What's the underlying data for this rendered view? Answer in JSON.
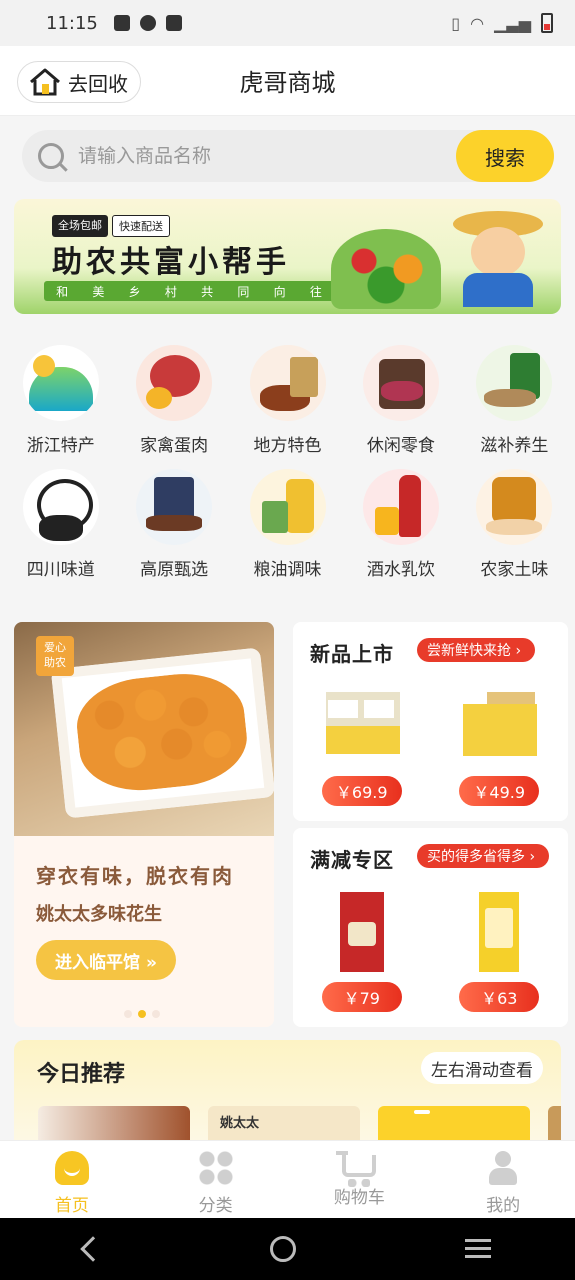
{
  "status_bar": {
    "time": "11:15"
  },
  "header": {
    "title": "虎哥商城",
    "recycle_label": "去回收"
  },
  "search": {
    "placeholder": "请输入商品名称",
    "button_label": "搜索"
  },
  "banner": {
    "tags": [
      "全场包邮",
      "快速配送"
    ],
    "title": "助农共富小帮手",
    "subtitle_chars": [
      "和",
      "美",
      "乡",
      "村",
      "共",
      "同",
      "向",
      "往"
    ]
  },
  "categories": [
    {
      "label": "浙江特产",
      "icon": "mountain-icon"
    },
    {
      "label": "家禽蛋肉",
      "icon": "meat-egg-icon"
    },
    {
      "label": "地方特色",
      "icon": "local-food-icon"
    },
    {
      "label": "休闲零食",
      "icon": "snack-icon"
    },
    {
      "label": "滋补养生",
      "icon": "health-icon"
    },
    {
      "label": "四川味道",
      "icon": "panda-icon"
    },
    {
      "label": "高原甄选",
      "icon": "plateau-icon"
    },
    {
      "label": "粮油调味",
      "icon": "oil-icon"
    },
    {
      "label": "酒水乳饮",
      "icon": "wine-icon"
    },
    {
      "label": "农家土味",
      "icon": "farm-icon"
    }
  ],
  "promo": {
    "badge": "爱心助农",
    "slogan": "穿衣有味，脱衣有肉",
    "product": "姚太太多味花生",
    "cta": "进入临平馆 »",
    "active_slide": 1,
    "slide_count": 3
  },
  "new_arrivals": {
    "title": "新品上市",
    "tag": "尝新鲜快来抢 ›",
    "items": [
      {
        "price": "￥69.9"
      },
      {
        "price": "￥49.9"
      }
    ]
  },
  "discount_zone": {
    "title": "满减专区",
    "tag": "买的得多省得多 ›",
    "items": [
      {
        "price": "￥79"
      },
      {
        "price": "￥63"
      }
    ]
  },
  "recommend": {
    "title": "今日推荐",
    "hint": "左右滑动查看",
    "card_brands": [
      "姚太太"
    ]
  },
  "tabbar": [
    {
      "label": "首页",
      "icon": "home-icon",
      "active": true
    },
    {
      "label": "分类",
      "icon": "category-icon",
      "active": false
    },
    {
      "label": "购物车",
      "icon": "cart-icon",
      "active": false
    },
    {
      "label": "我的",
      "icon": "user-icon",
      "active": false
    }
  ],
  "colors": {
    "accent": "#fcd22a",
    "price": "#e8301e",
    "tab_active": "#f5c020"
  }
}
